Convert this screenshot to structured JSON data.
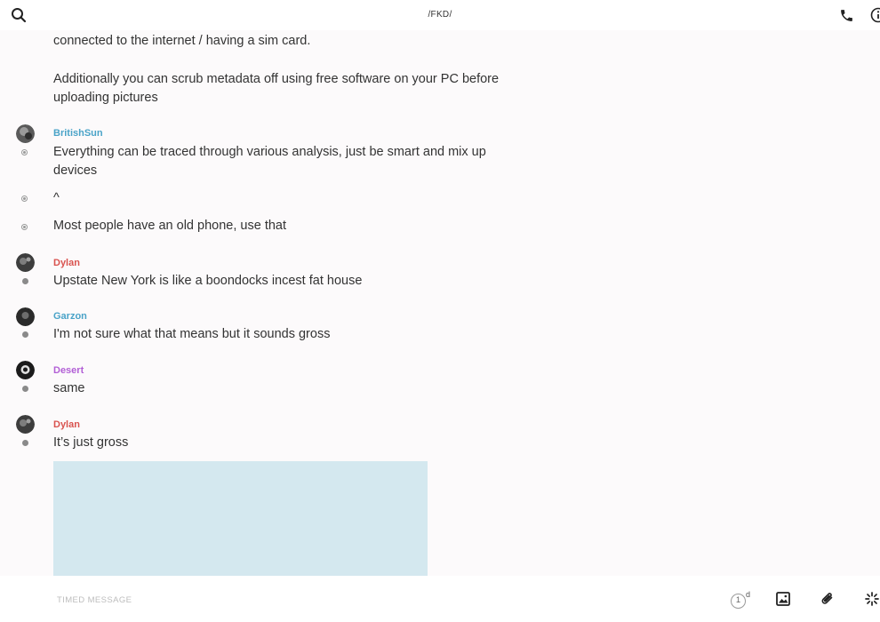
{
  "header": {
    "title": "/FKD/"
  },
  "messages": [
    {
      "text": "connected to the internet / having a sim card."
    },
    {
      "text": "Additionally you can scrub metadata off using free software on your PC before uploading pictures"
    },
    {
      "author": "BritishSun",
      "author_color": "#4aa3c8",
      "text": "Everything can be traced through various analysis, just be smart and mix up devices"
    },
    {
      "text": "^"
    },
    {
      "text": "Most people have an old phone, use that"
    },
    {
      "author": "Dylan",
      "author_color": "#d9534f",
      "text": "Upstate New York is like a boondocks incest fat house"
    },
    {
      "author": "Garzon",
      "author_color": "#4aa3c8",
      "text": "I'm not sure what that means but it sounds gross"
    },
    {
      "author": "Desert",
      "author_color": "#b25fd6",
      "text": "same"
    },
    {
      "author": "Dylan",
      "author_color": "#d9534f",
      "text": "It’s just gross"
    }
  ],
  "composer": {
    "placeholder": "TIMED MESSAGE",
    "timer_value": "1",
    "timer_unit": "d"
  },
  "icons": {
    "search": "search-icon",
    "call": "phone-icon",
    "info": "info-icon",
    "image": "image-icon",
    "attach": "paperclip-icon",
    "burst": "sparkle-icon"
  }
}
